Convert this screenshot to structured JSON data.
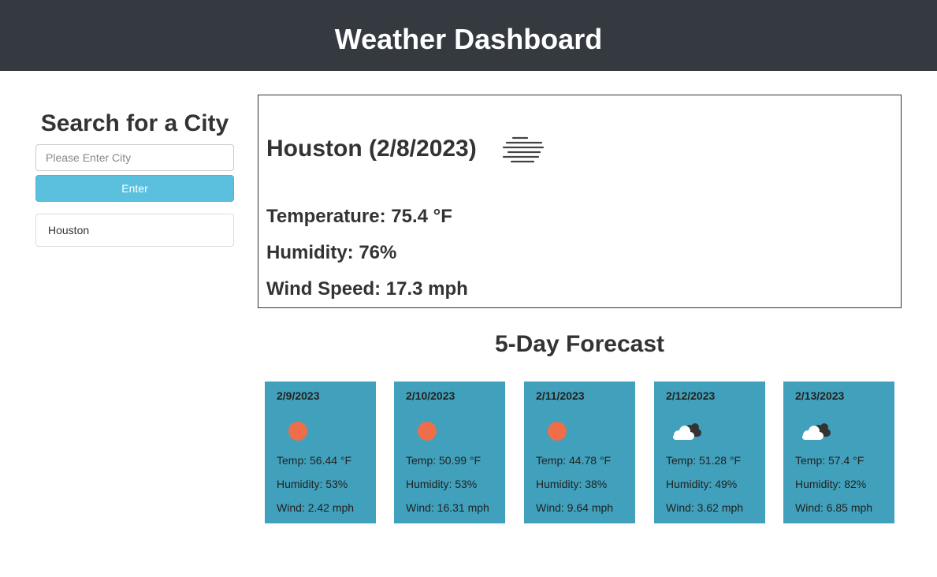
{
  "header": {
    "title": "Weather Dashboard"
  },
  "sidebar": {
    "title": "Search for a City",
    "search_placeholder": "Please Enter City",
    "search_value": "",
    "enter_label": "Enter",
    "history": [
      "Houston"
    ]
  },
  "current": {
    "title": "Houston (2/8/2023)",
    "icon": "mist-icon",
    "temperature": "Temperature: 75.4 °F",
    "humidity": "Humidity: 76%",
    "wind": "Wind Speed: 17.3 mph"
  },
  "forecast": {
    "title": "5-Day Forecast",
    "card_color": "#41a0bb",
    "days": [
      {
        "date": "2/9/2023",
        "icon": "sun-icon",
        "temp": "Temp: 56.44 °F",
        "humidity": "Humidity: 53%",
        "wind": "Wind: 2.42 mph"
      },
      {
        "date": "2/10/2023",
        "icon": "sun-icon",
        "temp": "Temp: 50.99 °F",
        "humidity": "Humidity: 53%",
        "wind": "Wind: 16.31 mph"
      },
      {
        "date": "2/11/2023",
        "icon": "sun-icon",
        "temp": "Temp: 44.78 °F",
        "humidity": "Humidity: 38%",
        "wind": "Wind: 9.64 mph"
      },
      {
        "date": "2/12/2023",
        "icon": "broken-clouds-icon",
        "temp": "Temp: 51.28 °F",
        "humidity": "Humidity: 49%",
        "wind": "Wind: 3.62 mph"
      },
      {
        "date": "2/13/2023",
        "icon": "broken-clouds-icon",
        "temp": "Temp: 57.4 °F",
        "humidity": "Humidity: 82%",
        "wind": "Wind: 6.85 mph"
      }
    ]
  }
}
